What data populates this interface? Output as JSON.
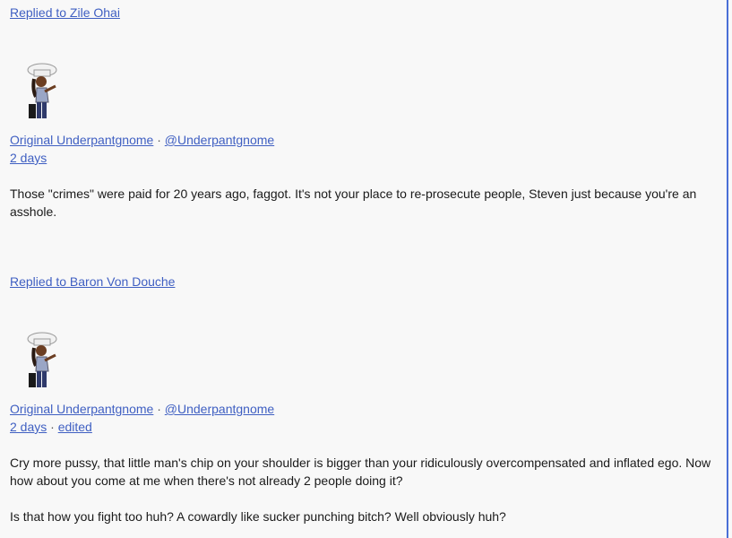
{
  "comments": [
    {
      "replied_to": "Replied to Zile Ohai",
      "author_name": "Original Underpantgnome",
      "author_handle": "@Underpantgnome",
      "separator": "·",
      "time": "2 days",
      "edited": "",
      "paragraphs": [
        "Those \"crimes\" were paid for 20 years ago, faggot. It's not your place to re-prosecute people, Steven just because you're an asshole."
      ]
    },
    {
      "replied_to": "Replied to Baron Von Douche",
      "author_name": "Original Underpantgnome",
      "author_handle": "@Underpantgnome",
      "separator": "·",
      "time": "2 days",
      "edited": "edited",
      "paragraphs": [
        "Cry more pussy, that little man's chip on your shoulder is bigger than your ridiculously overcompensated and inflated ego. Now how about you come at me when there's not already 2 people doing it?",
        "Is that how you fight too huh? A cowardly like sucker punching bitch? Well obviously huh?"
      ]
    }
  ],
  "colors": {
    "link": "#3f5fc2",
    "background": "#f8f8f8",
    "scroll_border": "#4a6fd6"
  },
  "icons": {
    "avatar": "chef-avatar-icon"
  }
}
